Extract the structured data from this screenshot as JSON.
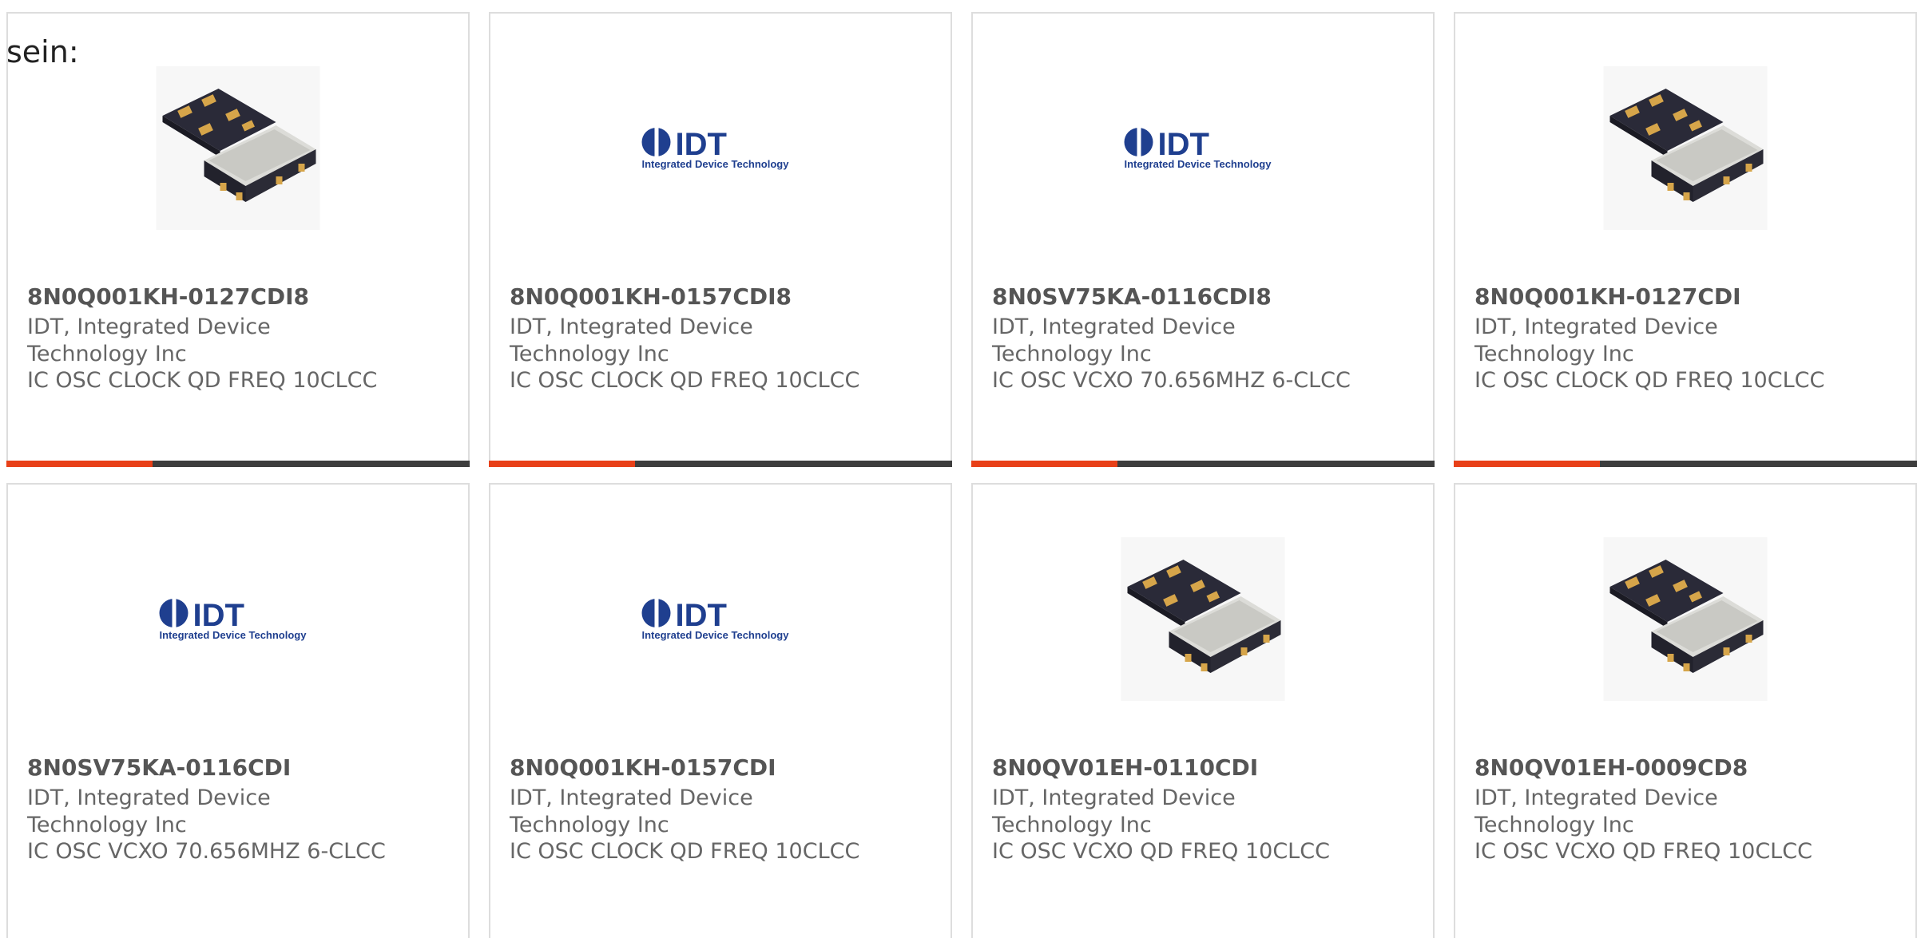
{
  "intro": {
    "label": "sein:"
  },
  "products": [
    {
      "part": "8N0Q001KH-0127CDI8",
      "maker": "IDT, Integrated Device Technology Inc",
      "desc": "IC OSC CLOCK QD FREQ 10CLCC",
      "image": "chip-photo",
      "image_alt": ""
    },
    {
      "part": "8N0Q001KH-0157CDI8",
      "maker": "IDT, Integrated Device Technology Inc",
      "desc": "IC OSC CLOCK QD FREQ 10CLCC",
      "image": "idt-logo",
      "logo_mark": "IDT",
      "logo_sub": "Integrated Device Technology"
    },
    {
      "part": "8N0SV75KA-0116CDI8",
      "maker": "IDT, Integrated Device Technology Inc",
      "desc": "IC OSC VCXO 70.656MHZ 6-CLCC",
      "image": "idt-logo",
      "logo_mark": "IDT",
      "logo_sub": "Integrated Device Technology"
    },
    {
      "part": "8N0Q001KH-0127CDI",
      "maker": "IDT, Integrated Device Technology Inc",
      "desc": "IC OSC CLOCK QD FREQ 10CLCC",
      "image": "chip-photo"
    },
    {
      "part": "8N0SV75KA-0116CDI",
      "maker": "IDT, Integrated Device Technology Inc",
      "desc": "IC OSC VCXO 70.656MHZ 6-CLCC",
      "image": "idt-logo",
      "logo_mark": "IDT",
      "logo_sub": "Integrated Device Technology"
    },
    {
      "part": "8N0Q001KH-0157CDI",
      "maker": "IDT, Integrated Device Technology Inc",
      "desc": "IC OSC CLOCK QD FREQ 10CLCC",
      "image": "idt-logo",
      "logo_mark": "IDT",
      "logo_sub": "Integrated Device Technology"
    },
    {
      "part": "8N0QV01EH-0110CDI",
      "maker": "IDT, Integrated Device Technology Inc",
      "desc": "IC OSC VCXO QD FREQ 10CLCC",
      "image": "chip-photo"
    },
    {
      "part": "8N0QV01EH-0009CD8",
      "maker": "IDT, Integrated Device Technology Inc",
      "desc": "IC OSC VCXO QD FREQ 10CLCC",
      "image": "chip-photo"
    }
  ],
  "colors": {
    "accent": "#e84018",
    "bar_dark": "#3d3d3d",
    "logo_blue": "#1f3f8f"
  }
}
